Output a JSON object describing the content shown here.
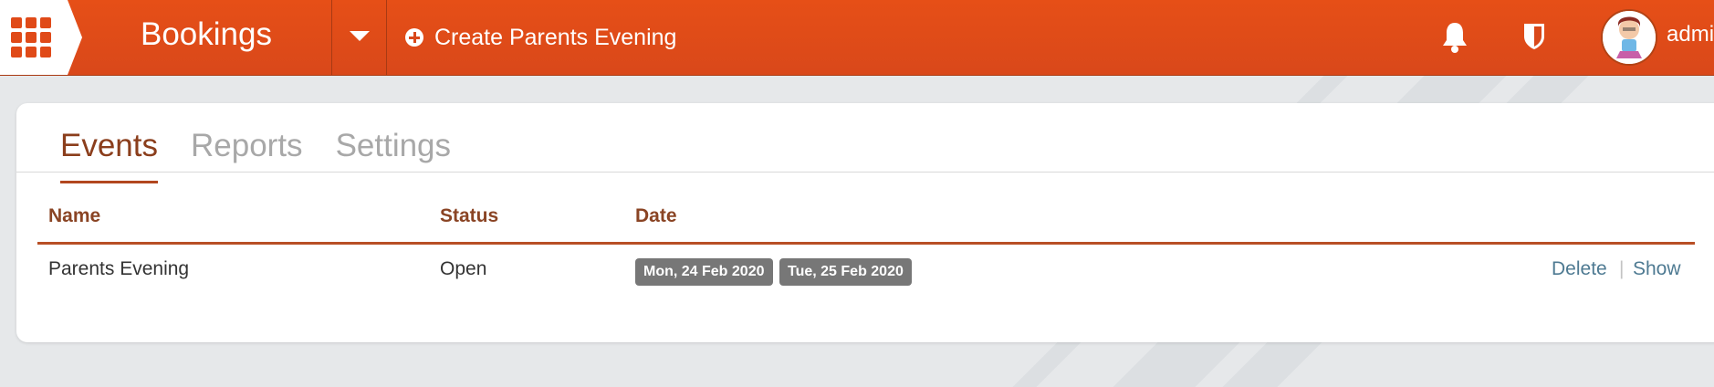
{
  "header": {
    "app_title": "Bookings",
    "create_label": "Create Parents Evening",
    "user_name": "admin",
    "brand_color": "#e04a18"
  },
  "tabs": [
    {
      "label": "Events",
      "active": true
    },
    {
      "label": "Reports",
      "active": false
    },
    {
      "label": "Settings",
      "active": false
    }
  ],
  "table": {
    "columns": [
      "Name",
      "Status",
      "Date"
    ],
    "rows": [
      {
        "name": "Parents Evening",
        "status": "Open",
        "dates": [
          "Mon, 24 Feb 2020",
          "Tue, 25 Feb 2020"
        ],
        "actions": [
          "Delete",
          "Show"
        ]
      }
    ]
  }
}
